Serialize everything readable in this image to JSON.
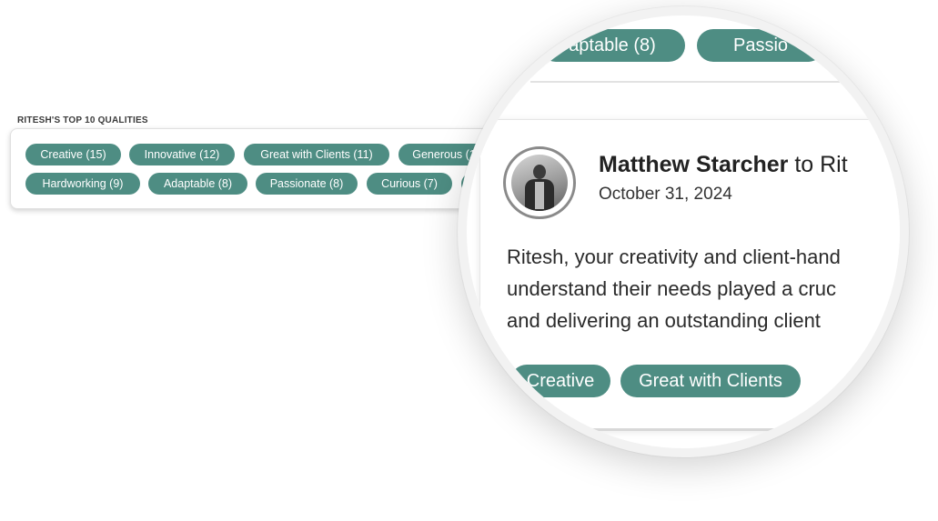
{
  "qualities": {
    "title": "RITESH'S TOP 10 QUALITIES",
    "row1": [
      "Creative (15)",
      "Innovative (12)",
      "Great with Clients (11)",
      "Generous (1"
    ],
    "row2": [
      "Hardworking (9)",
      "Adaptable (8)",
      "Passionate (8)",
      "Curious (7)",
      ""
    ]
  },
  "magnified": {
    "top_pills": [
      "aptable (8)",
      "Passio"
    ],
    "recommendation": {
      "author": "Matthew Starcher",
      "to_text": " to Rit",
      "date": "October 31, 2024",
      "text_lines": [
        "Ritesh, your creativity and client-hand",
        "understand their needs played a cruc",
        "and delivering an outstanding client"
      ],
      "tags": [
        "Creative",
        "Great with Clients"
      ]
    }
  },
  "colors": {
    "pill": "#4e8d83"
  }
}
